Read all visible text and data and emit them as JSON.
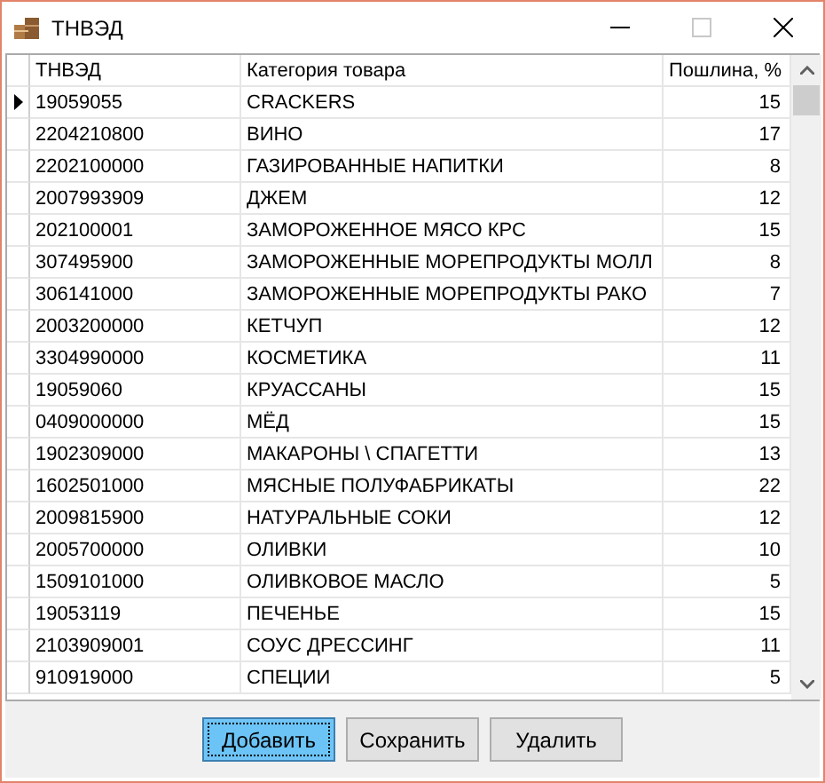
{
  "window": {
    "title": "ТНВЭД",
    "maximize_disabled": true
  },
  "table": {
    "columns": [
      "ТНВЭД",
      "Категория товара",
      "Пошлина, %"
    ],
    "rows": [
      {
        "code": "19059055",
        "category": "CRACKERS",
        "duty": "15",
        "current": true
      },
      {
        "code": "2204210800",
        "category": "ВИНО",
        "duty": "17",
        "current": false
      },
      {
        "code": "2202100000",
        "category": "ГАЗИРОВАННЫЕ НАПИТКИ",
        "duty": "8",
        "current": false
      },
      {
        "code": "2007993909",
        "category": "ДЖЕМ",
        "duty": "12",
        "current": false
      },
      {
        "code": "202100001",
        "category": "ЗАМОРОЖЕННОЕ МЯСО КРС",
        "duty": "15",
        "current": false
      },
      {
        "code": "307495900",
        "category": "ЗАМОРОЖЕННЫЕ МОРЕПРОДУКТЫ МОЛЛ",
        "duty": "8",
        "current": false
      },
      {
        "code": "306141000",
        "category": "ЗАМОРОЖЕННЫЕ МОРЕПРОДУКТЫ РАКО",
        "duty": "7",
        "current": false
      },
      {
        "code": "2003200000",
        "category": "КЕТЧУП",
        "duty": "12",
        "current": false
      },
      {
        "code": "3304990000",
        "category": "КОСМЕТИКА",
        "duty": "11",
        "current": false
      },
      {
        "code": "19059060",
        "category": "КРУАССАНЫ",
        "duty": "15",
        "current": false
      },
      {
        "code": "0409000000",
        "category": "МЁД",
        "duty": "15",
        "current": false
      },
      {
        "code": "1902309000",
        "category": "МАКАРОНЫ \\ СПАГЕТТИ",
        "duty": "13",
        "current": false
      },
      {
        "code": "1602501000",
        "category": "МЯСНЫЕ ПОЛУФАБРИКАТЫ",
        "duty": "22",
        "current": false
      },
      {
        "code": "2009815900",
        "category": "НАТУРАЛЬНЫЕ СОКИ",
        "duty": "12",
        "current": false
      },
      {
        "code": "2005700000",
        "category": "ОЛИВКИ",
        "duty": "10",
        "current": false
      },
      {
        "code": "1509101000",
        "category": "ОЛИВКОВОЕ МАСЛО",
        "duty": "5",
        "current": false
      },
      {
        "code": "19053119",
        "category": "ПЕЧЕНЬЕ",
        "duty": "15",
        "current": false
      },
      {
        "code": "2103909001",
        "category": "СОУС ДРЕССИНГ",
        "duty": "11",
        "current": false
      },
      {
        "code": "910919000",
        "category": "СПЕЦИИ",
        "duty": "5",
        "current": false
      }
    ]
  },
  "buttons": [
    {
      "label": "Добавить",
      "focused": true
    },
    {
      "label": "Сохранить",
      "focused": false
    },
    {
      "label": "Удалить",
      "focused": false
    }
  ]
}
